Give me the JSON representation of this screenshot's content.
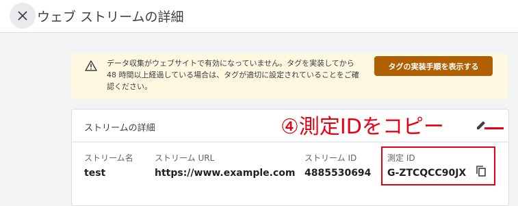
{
  "header": {
    "close_icon": "close-icon",
    "title": "ウェブ ストリームの詳細"
  },
  "banner": {
    "icon": "warning-icon",
    "line1": "データ収集がウェブサイトで有効になっていません。タグを実装してから",
    "line2": "48 時間以上経過している場合は、タグが適切に設定されていることをご確",
    "line3": "認ください。",
    "button_label": "タグの実装手順を表示する",
    "button_color": "#b06000",
    "background": "#fef7e0"
  },
  "card": {
    "title": "ストリームの詳細",
    "edit_icon": "pencil-icon",
    "fields": [
      {
        "label": "ストリーム名",
        "value": "test"
      },
      {
        "label": "ストリーム URL",
        "value": "https://www.example.com"
      },
      {
        "label": "ストリーム ID",
        "value": "4885530694"
      },
      {
        "label": "測定 ID",
        "value": "G-ZTCQCC90JX"
      }
    ],
    "copy_icon": "copy-icon"
  },
  "annotation": {
    "text": "④測定IDをコピー",
    "color": "#e60012"
  }
}
